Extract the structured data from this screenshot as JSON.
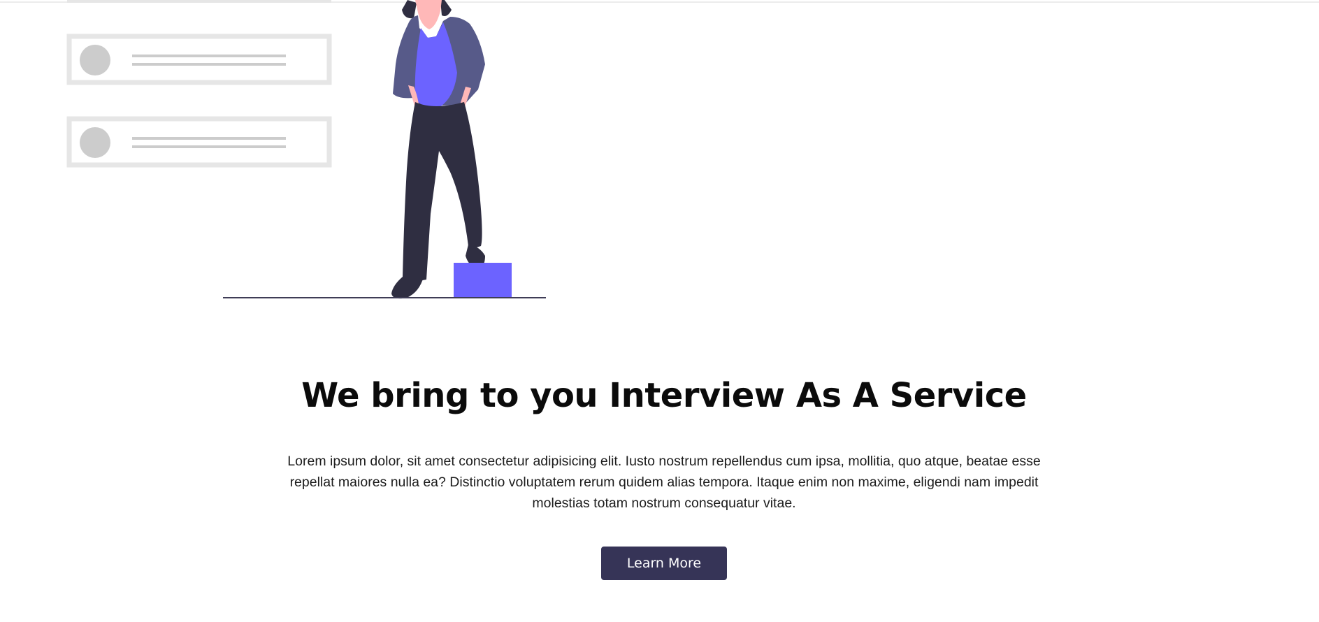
{
  "colors": {
    "accent": "#6c63ff",
    "button_bg": "#363457",
    "card_gray": "#e6e6e6",
    "placeholder_gray": "#cccccc",
    "jacket": "#575a89",
    "pants": "#2f2e41",
    "skin": "#ffb8b8"
  },
  "illustration": {
    "icon": "person-with-list-cards-illustration"
  },
  "hero": {
    "title": "We bring to you Interview As A Service",
    "description": "Lorem ipsum dolor, sit amet consectetur adipisicing elit. Iusto nostrum repellendus cum ipsa, mollitia, quo atque, beatae esse repellat maiores nulla ea? Distinctio voluptatem rerum quidem alias tempora. Itaque enim non maxime, eligendi nam impedit molestias totam nostrum consequatur vitae.",
    "button_label": "Learn More"
  }
}
